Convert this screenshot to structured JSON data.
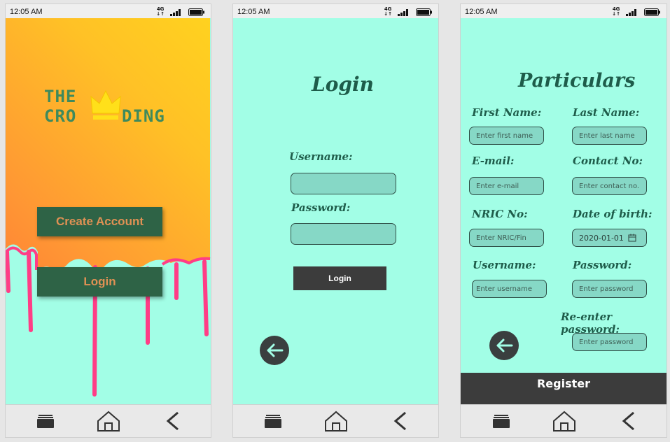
{
  "status_bar": {
    "time": "12:05 AM",
    "network": "4G"
  },
  "welcome": {
    "logo_line1": "THE",
    "logo_line2_left": "CRO",
    "logo_line2_right": "DING",
    "create_account_label": "Create Account",
    "login_label": "Login"
  },
  "login": {
    "title": "Login",
    "username_label": "Username:",
    "password_label": "Password:",
    "submit_label": "Login"
  },
  "particulars": {
    "title": "Particulars",
    "first_name_label": "First Name:",
    "first_name_placeholder": "Enter first name",
    "last_name_label": "Last Name:",
    "last_name_placeholder": "Enter last name",
    "email_label": "E-mail:",
    "email_placeholder": "Enter e-mail",
    "contact_label": "Contact No:",
    "contact_placeholder": "Enter contact no.",
    "nric_label": "NRIC No:",
    "nric_placeholder": "Enter NRIC/Fin",
    "dob_label": "Date of birth:",
    "dob_value": "2020-01-01",
    "username_label": "Username:",
    "username_placeholder": "Enter username",
    "password_label": "Password:",
    "password_placeholder": "Enter password",
    "reenter_label": "Re-enter password:",
    "reenter_placeholder": "Enter password",
    "register_label": "Register"
  },
  "colors": {
    "aqua_background": "#a2fee6",
    "dark_green": "#2e6346",
    "button_text_orange": "#e09154",
    "title_green": "#1e5c4a",
    "field_fill": "#86d8c6",
    "dark_gray": "#3a3f3f",
    "logo_green": "#3f8a5c",
    "drip_pink": "#ff3d86"
  },
  "icons": [
    "signal-icon",
    "battery-icon",
    "recents-icon",
    "home-icon",
    "back-nav-icon",
    "back-arrow-icon",
    "calendar-icon",
    "crown-icon"
  ]
}
